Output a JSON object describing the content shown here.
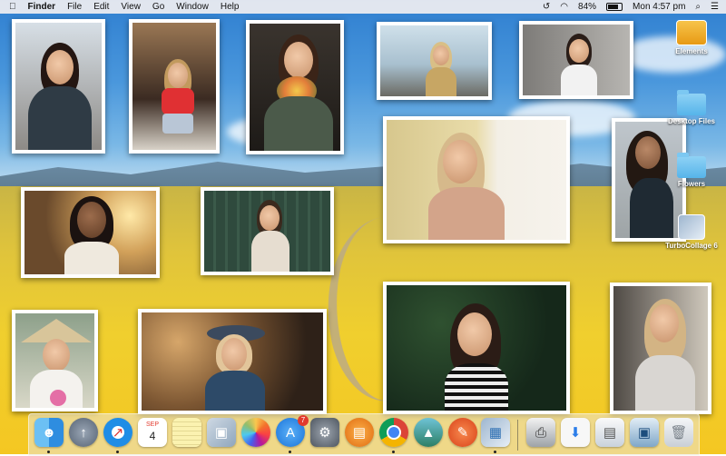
{
  "menubar": {
    "app_name": "Finder",
    "menus": [
      "File",
      "Edit",
      "View",
      "Go",
      "Window",
      "Help"
    ],
    "battery": "84%",
    "clock": "Mon 4:57 pm"
  },
  "desktop_icons": [
    {
      "label": "Elements",
      "icon": "disk-icon"
    },
    {
      "label": "Desktop Files",
      "icon": "folder-icon"
    },
    {
      "label": "Flowers",
      "icon": "folder-icon"
    },
    {
      "label": "TurboCollage 6",
      "icon": "app-icon"
    }
  ],
  "dock": {
    "apps": [
      {
        "name": "Finder",
        "icon": "finder-icon",
        "color": "#3e8fe0",
        "running": true
      },
      {
        "name": "Launchpad",
        "icon": "rocket-icon",
        "color": "#6d7a8a",
        "running": false
      },
      {
        "name": "Safari",
        "icon": "compass-icon",
        "color": "#1f8de6",
        "running": true
      },
      {
        "name": "Calendar",
        "icon": "calendar-icon",
        "color": "#ffffff",
        "running": false,
        "month": "SEP",
        "day": "4"
      },
      {
        "name": "Notes",
        "icon": "notes-icon",
        "color": "#f6e27a",
        "running": false
      },
      {
        "name": "Preview",
        "icon": "preview-icon",
        "color": "#d9e3ec",
        "running": false
      },
      {
        "name": "Photos",
        "icon": "photos-icon",
        "color": "#ffffff",
        "running": false
      },
      {
        "name": "App Store",
        "icon": "appstore-icon",
        "color": "#1f8ef0",
        "running": true,
        "badge": "7"
      },
      {
        "name": "System Preferences",
        "icon": "gear-icon",
        "color": "#7d8590",
        "running": false
      },
      {
        "name": "iBooks",
        "icon": "book-icon",
        "color": "#f08a1e",
        "running": false
      },
      {
        "name": "Chrome",
        "icon": "chrome-icon",
        "color": "#ffffff",
        "running": true
      },
      {
        "name": "Photo app",
        "icon": "landscape-icon",
        "color": "#4aa3a0",
        "running": false
      },
      {
        "name": "Pages",
        "icon": "pen-icon",
        "color": "#f0622a",
        "running": false
      },
      {
        "name": "TurboCollage",
        "icon": "collage-icon",
        "color": "#c9d3de",
        "running": true
      }
    ],
    "docs": [
      {
        "name": "Document stack",
        "icon": "printer-icon"
      },
      {
        "name": "Downloads stack",
        "icon": "downloads-icon"
      },
      {
        "name": "Screenshot stack",
        "icon": "stack-icon"
      },
      {
        "name": "Image stack",
        "icon": "photo-stack-icon"
      },
      {
        "name": "Trash",
        "icon": "trash-icon"
      }
    ]
  }
}
